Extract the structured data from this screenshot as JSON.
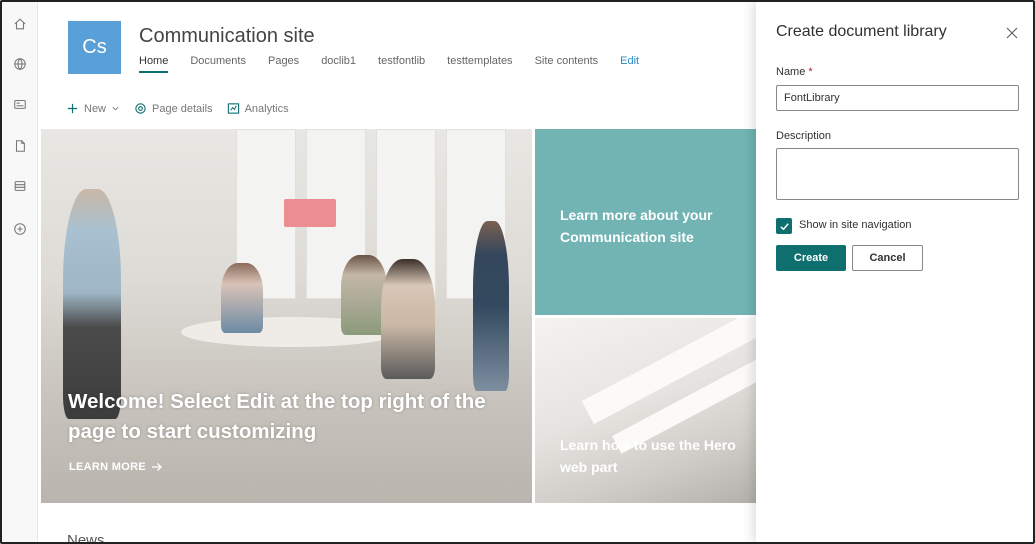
{
  "rail": {
    "icons": [
      "home-icon",
      "globe-icon",
      "news-icon",
      "document-icon",
      "list-icon",
      "add-circle-icon"
    ]
  },
  "site": {
    "logo_initials": "Cs",
    "title": "Communication site",
    "nav": [
      {
        "label": "Home",
        "active": true
      },
      {
        "label": "Documents"
      },
      {
        "label": "Pages"
      },
      {
        "label": "doclib1"
      },
      {
        "label": "testfontlib"
      },
      {
        "label": "testtemplates"
      },
      {
        "label": "Site contents"
      },
      {
        "label": "Edit"
      }
    ]
  },
  "commandbar": {
    "new_label": "New",
    "page_details_label": "Page details",
    "analytics_label": "Analytics"
  },
  "hero": {
    "main_title": "Welcome! Select Edit at the top right of the page to start customizing",
    "main_link": "LEARN MORE",
    "tile1_text": "Learn more about your Communication site",
    "tile2_text": "Learn how to use the Hero web part"
  },
  "news_heading": "News",
  "panel": {
    "title": "Create document library",
    "name_label": "Name",
    "name_required_marker": "*",
    "name_value": "FontLibrary",
    "description_label": "Description",
    "description_value": "",
    "show_in_nav_label": "Show in site navigation",
    "show_in_nav_checked": true,
    "create_label": "Create",
    "cancel_label": "Cancel"
  },
  "colors": {
    "accent": "#0f6e6e",
    "logo_bg": "#5aa0d8",
    "tile_teal": "#72b4b4"
  }
}
